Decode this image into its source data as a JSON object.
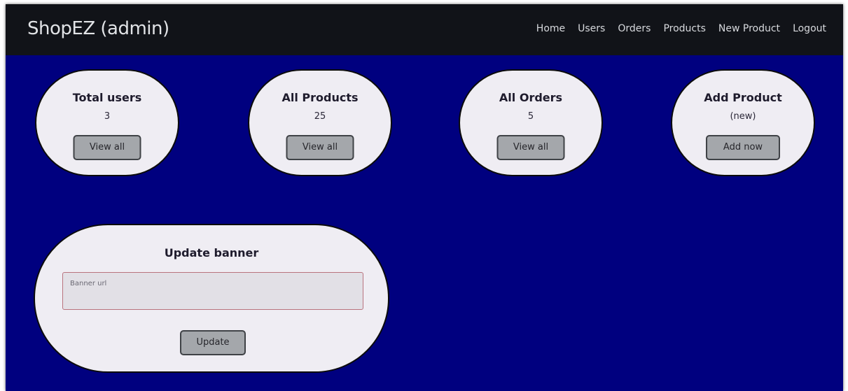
{
  "navbar": {
    "brand": "ShopEZ (admin)",
    "links": [
      "Home",
      "Users",
      "Orders",
      "Products",
      "New Product",
      "Logout"
    ]
  },
  "cards": [
    {
      "title": "Total users",
      "value": "3",
      "button": "View all"
    },
    {
      "title": "All Products",
      "value": "25",
      "button": "View all"
    },
    {
      "title": "All Orders",
      "value": "5",
      "button": "View all"
    },
    {
      "title": "Add Product",
      "value": "(new)",
      "button": "Add now"
    }
  ],
  "banner": {
    "title": "Update banner",
    "placeholder": "Banner url",
    "button": "Update"
  },
  "colors": {
    "background": "#00007f",
    "navbar": "#111318",
    "card": "#efedf3",
    "button": "#a4a7ab",
    "input_border": "#b9737e"
  }
}
